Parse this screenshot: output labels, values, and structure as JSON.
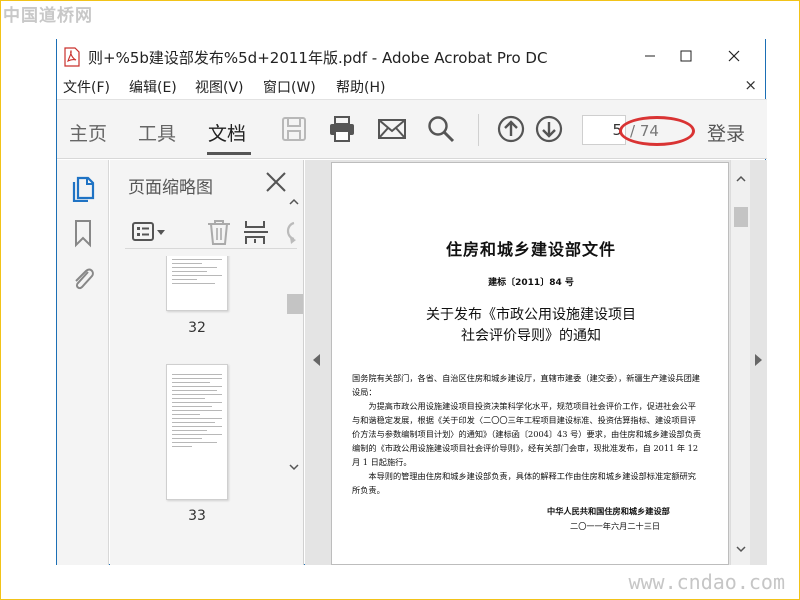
{
  "watermarks": {
    "top": "中国道桥网",
    "bottom": "www.cndao.com"
  },
  "window": {
    "title": "则+%5b建设部发布%5d+2011年版.pdf - Adobe Acrobat Pro DC",
    "border_color": "#1b6fb5"
  },
  "menu": {
    "items": [
      "文件(F)",
      "编辑(E)",
      "视图(V)",
      "窗口(W)",
      "帮助(H)"
    ],
    "close": "×"
  },
  "toolbar": {
    "tabs": [
      "主页",
      "工具",
      "文档"
    ],
    "active_tab": "文档",
    "page_current": "5",
    "page_total": "/ 74",
    "login": "登录",
    "icons": [
      "save-icon",
      "print-icon",
      "email-icon",
      "search-icon",
      "page-up-icon",
      "page-down-icon"
    ]
  },
  "annotation": {
    "oval_color": "#d93333"
  },
  "sidebar": {
    "icons": [
      "page-thumbnails-icon",
      "bookmark-icon",
      "attachment-icon"
    ]
  },
  "thumbnails_panel": {
    "title": "页面缩略图",
    "tool_icons": [
      "thumbnail-options-icon",
      "delete-icon",
      "insert-page-icon",
      "rotate-icon"
    ],
    "pages": [
      {
        "number": "32"
      },
      {
        "number": "33"
      }
    ]
  },
  "document_page": {
    "header": "住房和城乡建设部文件",
    "doc_number": "建标〔2011〕84 号",
    "subject_line1": "关于发布《市政公用设施建设项目",
    "subject_line2": "社会评价导则》的通知",
    "salutation": "国务院有关部门，各省、自治区住房和城乡建设厅，直辖市建委（建交委），新疆生产建设兵团建设局：",
    "para1": "为提高市政公用设施建设项目投资决策科学化水平，规范项目社会评价工作，促进社会公平与和谐稳定发展，根据《关于印发〈二〇〇三年工程项目建设标准、投资估算指标、建设项目评价方法与参数编制项目计划〉的通知》（建标函〔2004〕43 号）要求，由住房和城乡建设部负责编制的《市政公用设施建设项目社会评价导则》，经有关部门会审，现批准发布，自 2011 年 12 月 1 日起施行。",
    "para2": "本导则的管理由住房和城乡建设部负责，具体的解释工作由住房和城乡建设部标准定额研究所负责。",
    "signature": "中华人民共和国住房和城乡建设部",
    "date": "二〇一一年六月二十三日"
  }
}
